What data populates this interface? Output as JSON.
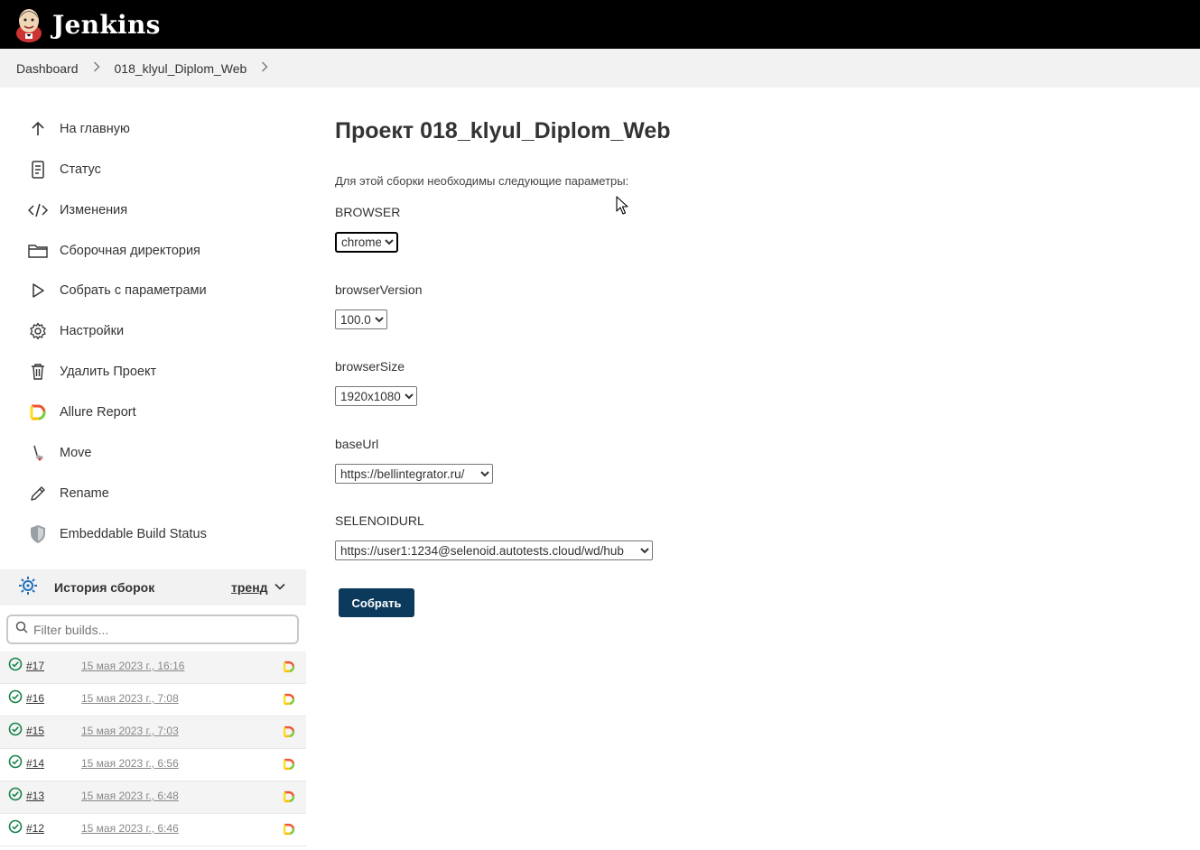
{
  "header": {
    "title": "Jenkins",
    "logo_icon": "jenkins-butler-icon"
  },
  "breadcrumb": {
    "items": [
      "Dashboard",
      "018_klyul_Diplom_Web"
    ]
  },
  "sidebar": {
    "tasks": [
      {
        "label": "На главную",
        "icon": "arrow-up-icon"
      },
      {
        "label": "Статус",
        "icon": "document-icon"
      },
      {
        "label": "Изменения",
        "icon": "code-icon"
      },
      {
        "label": "Сборочная директория",
        "icon": "folder-icon"
      },
      {
        "label": "Собрать с параметрами",
        "icon": "play-icon"
      },
      {
        "label": "Настройки",
        "icon": "gear-icon"
      },
      {
        "label": "Удалить Проект",
        "icon": "trash-icon"
      },
      {
        "label": "Allure Report",
        "icon": "allure-icon"
      },
      {
        "label": "Move",
        "icon": "move-icon"
      },
      {
        "label": "Rename",
        "icon": "pencil-icon"
      },
      {
        "label": "Embeddable Build Status",
        "icon": "shield-icon"
      }
    ]
  },
  "history": {
    "title": "История сборок",
    "trend": "тренд",
    "filter_placeholder": "Filter builds...",
    "builds": [
      {
        "number": "#17",
        "date": "15 мая 2023 г., 16:16"
      },
      {
        "number": "#16",
        "date": "15 мая 2023 г., 7:08"
      },
      {
        "number": "#15",
        "date": "15 мая 2023 г., 7:03"
      },
      {
        "number": "#14",
        "date": "15 мая 2023 г., 6:56"
      },
      {
        "number": "#13",
        "date": "15 мая 2023 г., 6:48"
      },
      {
        "number": "#12",
        "date": "15 мая 2023 г., 6:46"
      }
    ]
  },
  "main": {
    "title": "Проект 018_klyul_Diplom_Web",
    "intro": "Для этой сборки необходимы следующие параметры:",
    "params": {
      "browser": {
        "label": "BROWSER",
        "value": "chrome"
      },
      "browserVersion": {
        "label": "browserVersion",
        "value": "100.0"
      },
      "browserSize": {
        "label": "browserSize",
        "value": "1920x1080"
      },
      "baseUrl": {
        "label": "baseUrl",
        "value": "https://bellintegrator.ru/"
      },
      "selenoid": {
        "label": "SELENOIDURL",
        "value": "https://user1:1234@selenoid.autotests.cloud/wd/hub"
      }
    },
    "submit": "Собрать"
  },
  "colors": {
    "header_bg": "#000000",
    "submit_bg": "#0b3a5c",
    "success": "#138347"
  }
}
